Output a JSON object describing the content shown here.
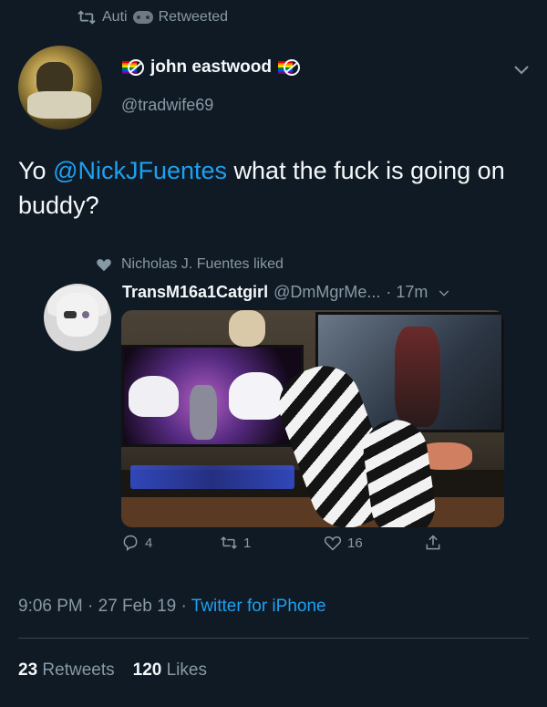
{
  "retweet": {
    "user": "Auti",
    "label": "Retweeted"
  },
  "author": {
    "display_name": "john eastwood",
    "handle": "@tradwife69"
  },
  "tweet": {
    "prefix": "Yo ",
    "mention": "@NickJFuentes",
    "suffix": " what the fuck is going on buddy?"
  },
  "quoted": {
    "liked_by": "Nicholas J. Fuentes liked",
    "display_name": "TransM16a1Catgirl",
    "handle": "@DmMgrMe...",
    "time": "· 17m",
    "actions": {
      "replies": "4",
      "retweets": "1",
      "likes": "16"
    }
  },
  "footer": {
    "time": "9:06 PM · 27 Feb 19 · ",
    "app": "Twitter for iPhone",
    "retweets_count": "23",
    "retweets_label": "Retweets",
    "likes_count": "120",
    "likes_label": "Likes"
  },
  "colors": {
    "background": "#101a24",
    "accent": "#1da1f2",
    "muted": "#8899a6"
  }
}
